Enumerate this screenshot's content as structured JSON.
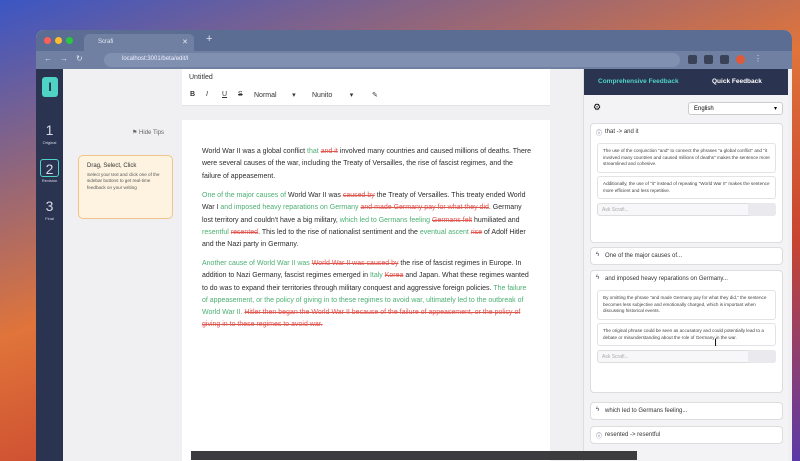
{
  "browser": {
    "tab_title": "Scrafi",
    "url": "localhost:3001/beta/edit/l",
    "colors": {
      "close": "#ff5f57",
      "min": "#febc2e",
      "max": "#28c840"
    }
  },
  "rail": {
    "logo": "I",
    "steps": [
      {
        "num": "1",
        "label": "Original"
      },
      {
        "num": "2",
        "label": "Revision"
      },
      {
        "num": "3",
        "label": "Final"
      }
    ]
  },
  "editor": {
    "hide_tips": "Hide Tips",
    "tip_title": "Drag, Select, Click",
    "tip_body": "Select your text and click one of the sidebar buttons to get real-time feedback on your writing",
    "doc_title": "Untitled",
    "toolbar": {
      "bold": "B",
      "italic": "I",
      "underline": "U",
      "strike": "S",
      "style": "Normal",
      "font": "Nunito"
    }
  },
  "feedback": {
    "tabs": [
      "Comprehensive Feedback",
      "Quick Feedback"
    ],
    "language": "English",
    "cards": [
      {
        "title": "that -> and it",
        "fb1": "The use of the conjunction \"and\" to connect the phrases \"a global conflict\" and \"it involved many countries and caused millions of deaths\" makes the sentence more streamlined and cohesive.",
        "fb2": "Additionally, the use of \"it\" instead of repeating \"World War II\" makes the sentence more efficient and less repetitive.",
        "ask": "Ask Scrafi..."
      },
      {
        "title": "One of the major causes of..."
      },
      {
        "title": "and imposed heavy reparations on Germany...",
        "fb1": "By omitting the phrase \"and made Germany pay for what they did,\" the sentence becomes less subjective and emotionally charged, which is important when discussing historical events.",
        "fb2": "The original phrase could be seen as accusatory and could potentially lead to a debate or misunderstanding about the role of Germany in the war.",
        "ask": "Ask Scrafi..."
      },
      {
        "title": "which led to Germans feeling..."
      },
      {
        "title": "resented -> resentful"
      }
    ]
  }
}
